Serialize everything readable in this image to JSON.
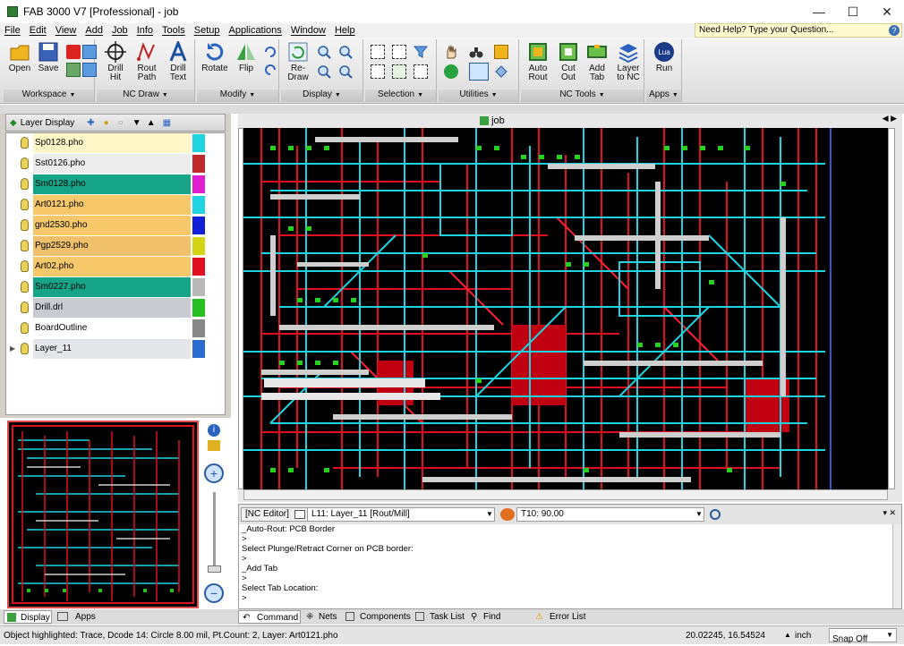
{
  "window": {
    "title": "FAB 3000 V7 [Professional] - job",
    "minimize": "—",
    "maximize": "☐",
    "close": "✕"
  },
  "menu": [
    "File",
    "Edit",
    "View",
    "Add",
    "Job",
    "Info",
    "Tools",
    "Setup",
    "Applications",
    "Window",
    "Help"
  ],
  "help_box": "Need Help? Type your Question...",
  "ribbon": {
    "workspace": {
      "label": "Workspace",
      "open": "Open",
      "save": "Save"
    },
    "nc_draw": {
      "label": "NC Draw",
      "drill_hit": "Drill Hit",
      "rout_path": "Rout Path",
      "drill_text": "Drill Text"
    },
    "modify": {
      "label": "Modify",
      "rotate": "Rotate",
      "flip": "Flip"
    },
    "display": {
      "label": "Display",
      "redraw": "Re-Draw"
    },
    "selection": {
      "label": "Selection"
    },
    "utilities": {
      "label": "Utilities"
    },
    "nc_tools": {
      "label": "NC Tools",
      "auto_rout": "Auto Rout",
      "cut_out": "Cut Out",
      "add_tab": "Add Tab",
      "layer_to_nc": "Layer to NC"
    },
    "apps": {
      "label": "Apps",
      "run": "Run",
      "lua": "Lua"
    }
  },
  "layer_panel": {
    "title": "Layer Display",
    "layers": [
      {
        "name": "Sp0128.pho",
        "bg": "#fff7c8",
        "color": "#1fd3e0"
      },
      {
        "name": "Sst0126.pho",
        "bg": "#ececec",
        "color": "#c0282c"
      },
      {
        "name": "Sm0128.pho",
        "bg": "#16a488",
        "color": "#e020d0"
      },
      {
        "name": "Art0121.pho",
        "bg": "#f7c86a",
        "color": "#1fd3e0"
      },
      {
        "name": "gnd2530.pho",
        "bg": "#f7c86a",
        "color": "#1020d8"
      },
      {
        "name": "Pgp2529.pho",
        "bg": "#f0c06a",
        "color": "#d4d414"
      },
      {
        "name": "Art02.pho",
        "bg": "#f7c86a",
        "color": "#e01020"
      },
      {
        "name": "Sm0227.pho",
        "bg": "#16a488",
        "color": "#b8b8b8"
      },
      {
        "name": "Drill.drl",
        "bg": "#c8ccd2",
        "color": "#28c020"
      },
      {
        "name": "BoardOutline",
        "bg": "#ffffff",
        "color": "#888888"
      },
      {
        "name": "Layer_11",
        "bg": "#e4e6ea",
        "color": "#2b6cd0"
      }
    ]
  },
  "doc_tab": "job",
  "nc_editor": {
    "header": "[NC Editor]",
    "layer_select": "L11: Layer_11 [Rout/Mill]",
    "tool_select": "T10: 90.00",
    "lines": [
      "_Auto-Rout: PCB Border",
      ">",
      "Select Plunge/Retract Corner on PCB border:",
      ">",
      "_Add Tab",
      ">",
      "Select Tab Location:",
      ">"
    ]
  },
  "bottom_tabs": {
    "display": "Display",
    "apps": "Apps",
    "command": "Command",
    "nets": "Nets",
    "components": "Components",
    "task_list": "Task List",
    "find_results": "Find Results",
    "error_list": "Error List"
  },
  "status": {
    "message": "Object highlighted:  Trace, Dcode 14: Circle 8.00 mil, Pt.Count: 2, Layer: Art0121.pho",
    "coords": "20.02245, 16.54524",
    "units": "inch",
    "snap": "Snap Off"
  }
}
